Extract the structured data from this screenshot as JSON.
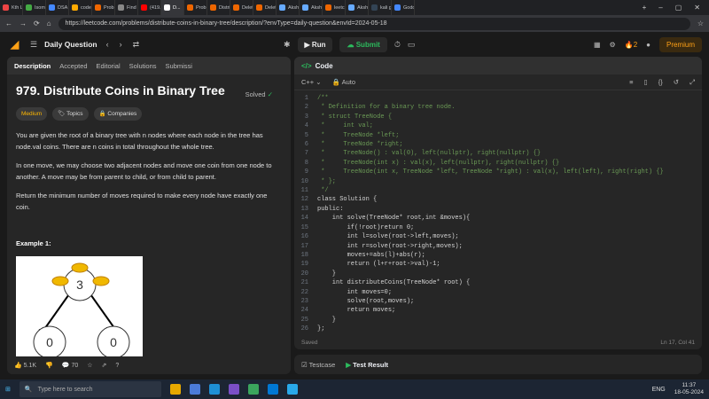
{
  "browser": {
    "tabs": [
      "Kth L...",
      "Isom...",
      "DSA l...",
      "codef...",
      "Probl...",
      "Find ...",
      "(419...",
      "D...",
      "Probl...",
      "Distri...",
      "Delet...",
      "Delet...",
      "Aksh...",
      "Aksh...",
      "leetc...",
      "Aksh...",
      "kali g...",
      "Godd..."
    ],
    "url": "https://leetcode.com/problems/distribute-coins-in-binary-tree/description/?envType=daily-question&envId=2024-05-18"
  },
  "topnav": {
    "daily_question": "Daily Question",
    "run": "Run",
    "submit": "Submit",
    "streak": "2",
    "premium": "Premium"
  },
  "left": {
    "tabs": [
      "Description",
      "Accepted",
      "Editorial",
      "Solutions",
      "Submissi"
    ],
    "title": "979. Distribute Coins in Binary Tree",
    "solved": "Solved",
    "tag_medium": "Medium",
    "tag_topics": "Topics",
    "tag_companies": "Companies",
    "p1": "You are given the root of a binary tree with n nodes where each node in the tree has node.val coins. There are n coins in total throughout the whole tree.",
    "p2": "In one move, we may choose two adjacent nodes and move one coin from one node to another. A move may be from parent to child, or from child to parent.",
    "p3": "Return the minimum number of moves required to make every node have exactly one coin.",
    "example": "Example 1:",
    "tree_root": "3",
    "tree_left": "0",
    "tree_right": "0",
    "likes": "5.1K",
    "comments": "70"
  },
  "right": {
    "title": "Code",
    "lang": "C++",
    "auto": "Auto",
    "status_left": "Saved",
    "status_right": "Ln 17, Col 41",
    "lines": [
      "/**",
      " * Definition for a binary tree node.",
      " * struct TreeNode {",
      " *     int val;",
      " *     TreeNode *left;",
      " *     TreeNode *right;",
      " *     TreeNode() : val(0), left(nullptr), right(nullptr) {}",
      " *     TreeNode(int x) : val(x), left(nullptr), right(nullptr) {}",
      " *     TreeNode(int x, TreeNode *left, TreeNode *right) : val(x), left(left), right(right) {}",
      " * };",
      " */",
      "class Solution {",
      "public:",
      "    int solve(TreeNode* root,int &moves){",
      "        if(!root)return 0;",
      "        int l=solve(root->left,moves);",
      "        int r=solve(root->right,moves);",
      "        moves+=abs(l)+abs(r);",
      "        return (l+r+root->val)-1;",
      "    }",
      "    int distributeCoins(TreeNode* root) {",
      "        int moves=0;",
      "        solve(root,moves);",
      "        return moves;",
      "    }",
      "};"
    ]
  },
  "bottom": {
    "testcase": "Testcase",
    "result": "Test Result"
  },
  "taskbar": {
    "search": "Type here to search",
    "lang": "ENG",
    "time": "11:37",
    "date": "18-05-2024"
  }
}
